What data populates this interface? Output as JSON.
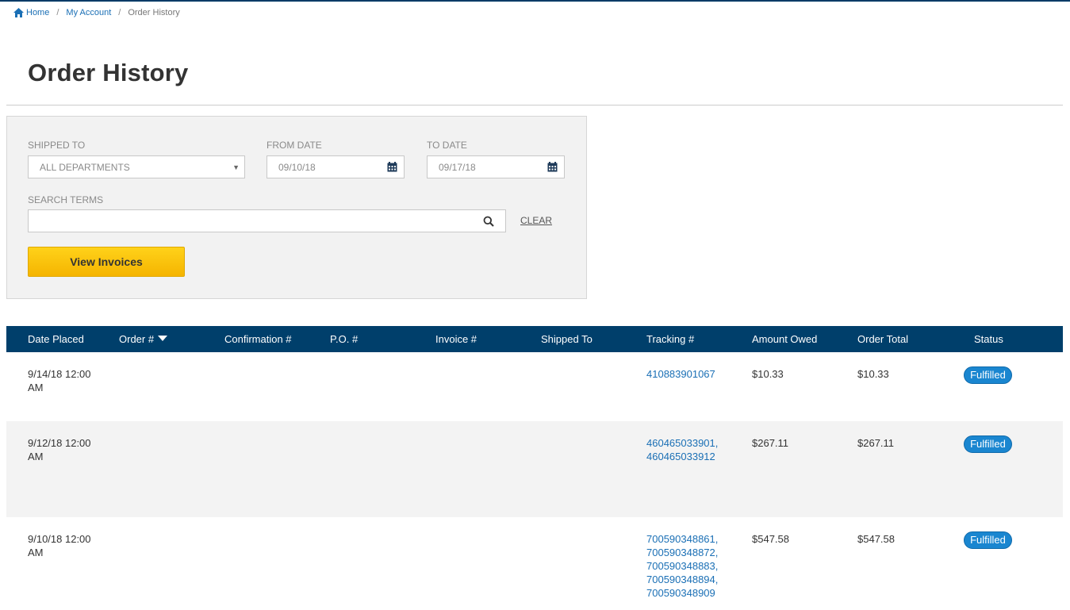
{
  "breadcrumb": {
    "home": "Home",
    "my_account": "My Account",
    "current": "Order History",
    "separator": "/"
  },
  "page_title": "Order History",
  "filters": {
    "shipped_to_label": "SHIPPED TO",
    "shipped_to_value": "ALL DEPARTMENTS",
    "from_date_label": "FROM DATE",
    "from_date_value": "09/10/18",
    "to_date_label": "TO DATE",
    "to_date_value": "09/17/18",
    "search_label": "SEARCH TERMS",
    "search_value": "",
    "clear_label": "CLEAR",
    "view_invoices_label": "View Invoices"
  },
  "table": {
    "columns": [
      "Date Placed",
      "Order #",
      "Confirmation #",
      "P.O. #",
      "Invoice #",
      "Shipped To",
      "Tracking #",
      "Amount Owed",
      "Order Total",
      "Status"
    ],
    "rows": [
      {
        "date_line1": "9/14/18 12:00",
        "date_line2": "AM",
        "tracking": [
          "410883901067"
        ],
        "amount_owed": "$10.33",
        "order_total": "$10.33",
        "status": "Fulfilled"
      },
      {
        "date_line1": "9/12/18 12:00",
        "date_line2": "AM",
        "tracking": [
          "460465033901,",
          "460465033912"
        ],
        "amount_owed": "$267.11",
        "order_total": "$267.11",
        "status": "Fulfilled"
      },
      {
        "date_line1": "9/10/18 12:00",
        "date_line2": "AM",
        "tracking": [
          "700590348861,",
          "700590348872,",
          "700590348883,",
          "700590348894,",
          "700590348909"
        ],
        "amount_owed": "$547.58",
        "order_total": "$547.58",
        "status": "Fulfilled"
      }
    ]
  },
  "colors": {
    "header_bg": "#003f6b",
    "link": "#1a6fb5",
    "button_yellow": "#f5b400",
    "badge_blue": "#1a86d0"
  }
}
